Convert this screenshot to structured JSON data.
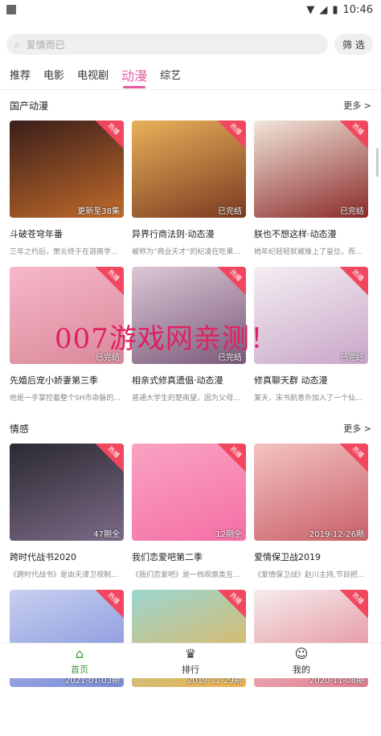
{
  "status": {
    "time": "10:46"
  },
  "search": {
    "placeholder": "爱情而已",
    "filter_label": "筛 选"
  },
  "tabs": [
    {
      "label": "推荐"
    },
    {
      "label": "电影"
    },
    {
      "label": "电视剧"
    },
    {
      "label": "动漫",
      "active": true
    },
    {
      "label": "综艺"
    }
  ],
  "sections": [
    {
      "title": "国产动漫",
      "more": "更多 >",
      "items": [
        {
          "title": "斗破苍穹年番",
          "desc": "三年之约后，萧炎终于在迦南学...",
          "ep": "更新至38集",
          "badge": "热播",
          "c1": "#3a1e1a",
          "c2": "#c06a2a"
        },
        {
          "title": "异界行商法则·动态漫",
          "desc": "被称为“商业天才”的纪凌在吃果...",
          "ep": "已完结",
          "badge": "热播",
          "c1": "#e9b15a",
          "c2": "#7a3a20"
        },
        {
          "title": "朕也不想这样·动态漫",
          "desc": "她年纪轻轻就被推上了皇位，而...",
          "ep": "已完结",
          "badge": "热播",
          "c1": "#f2e6da",
          "c2": "#8a2a2a"
        },
        {
          "title": "先婚后宠小娇妻第三季",
          "desc": "他是一手掌控着整个SH市命脉的...",
          "ep": "已完结",
          "badge": "热播",
          "c1": "#f6b8c8",
          "c2": "#d9889a"
        },
        {
          "title": "相亲式修真遗倡·动态漫",
          "desc": "普通大学生的楚南望，因为父母...",
          "ep": "已完结",
          "badge": "热播",
          "c1": "#dcc7d6",
          "c2": "#7a5a7a"
        },
        {
          "title": "修真聊天群 动态漫",
          "desc": "某天，宋书航意外加入了一个仙...",
          "ep": "已完结",
          "badge": "热播",
          "c1": "#f4eef2",
          "c2": "#c9a6c8"
        }
      ]
    },
    {
      "title": "情感",
      "more": "更多 >",
      "items": [
        {
          "title": "跨时代战书2020",
          "desc": "《跨时代战书》是由天津卫视制...",
          "ep": "47期全",
          "badge": "热播",
          "c1": "#2a2a30",
          "c2": "#7d6a88"
        },
        {
          "title": "我们恋爱吧第二季",
          "desc": "《我们恋爱吧》是一档观察类互...",
          "ep": "12期全",
          "badge": "热播",
          "c1": "#f9a3c2",
          "c2": "#f56fa5"
        },
        {
          "title": "爱情保卫战2019",
          "desc": "《爱情保卫战》赵川主持,节目把...",
          "ep": "2019-12-26期",
          "badge": "热播",
          "c1": "#f3c3c0",
          "c2": "#c9606a"
        },
        {
          "title": "",
          "desc": "",
          "ep": "2021-01-03期",
          "badge": "热播",
          "c1": "#c7d0f0",
          "c2": "#7a8ad8"
        },
        {
          "title": "",
          "desc": "",
          "ep": "2019-11-29期",
          "badge": "热播",
          "c1": "#9ad6d0",
          "c2": "#f0b04a"
        },
        {
          "title": "",
          "desc": "",
          "ep": "2020-11-08期",
          "badge": "热播",
          "c1": "#f5ecec",
          "c2": "#e07a8a"
        }
      ]
    }
  ],
  "watermark": "007游戏网亲测！",
  "bottom_nav": [
    {
      "label": "首页",
      "active": true
    },
    {
      "label": "排行"
    },
    {
      "label": "我的"
    }
  ]
}
